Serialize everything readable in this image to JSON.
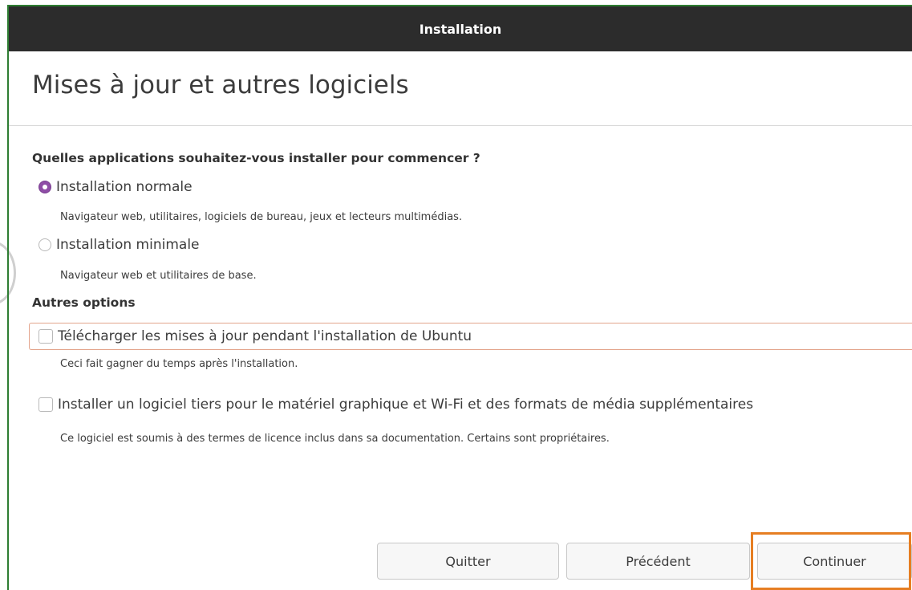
{
  "window": {
    "title": "Installation"
  },
  "page": {
    "heading": "Mises à jour et autres logiciels"
  },
  "apps_section": {
    "question": "Quelles applications souhaitez-vous installer pour commencer ?",
    "options": [
      {
        "label": "Installation normale",
        "description": "Navigateur web, utilitaires, logiciels de bureau, jeux et lecteurs multimédias.",
        "selected": true
      },
      {
        "label": "Installation minimale",
        "description": "Navigateur web et utilitaires de base.",
        "selected": false
      }
    ]
  },
  "other_options": {
    "title": "Autres options",
    "items": [
      {
        "label": "Télécharger les mises à jour pendant l'installation de Ubuntu",
        "description": "Ceci fait gagner du temps après l'installation.",
        "checked": false
      },
      {
        "label": "Installer un logiciel tiers pour le matériel graphique et Wi-Fi et des formats de média supplémentaires",
        "description": "Ce logiciel est soumis à des termes de licence inclus dans sa documentation. Certains sont propriétaires.",
        "checked": false
      }
    ]
  },
  "buttons": {
    "quit": "Quitter",
    "previous": "Précédent",
    "continue": "Continuer"
  },
  "colors": {
    "accent": "#8e4da6",
    "highlight": "#e67e22",
    "titlebar": "#2c2c2c"
  }
}
